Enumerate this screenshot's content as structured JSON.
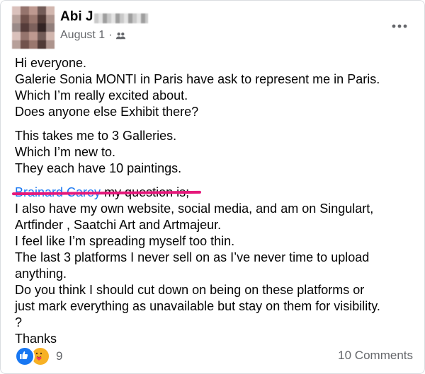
{
  "post": {
    "author_name": "Abi J",
    "date": "August 1",
    "separator": "·",
    "audience_icon": "friends-icon",
    "more_icon": "more-horizontal-icon"
  },
  "body": {
    "paragraph1": [
      "Hi everyone.",
      "Galerie Sonia MONTI in Paris have ask to represent me in Paris.",
      "Which I’m really excited about.",
      "Does anyone else Exhibit there?"
    ],
    "paragraph2": [
      "This takes me to 3 Galleries.",
      "Which I’m new to.",
      "They each have 10 paintings."
    ],
    "mention": "Brainard Carey",
    "mention_suffix": " my question is;",
    "paragraph3": [
      "I also have my own website, social media, and am on Singulart,",
      "Artfinder , Saatchi Art and Artmajeur.",
      "I feel like I’m spreading myself too thin.",
      "The last 3 platforms I never sell on as I’ve never time to upload",
      "anything.",
      "Do you think I should cut down on being on these platforms or",
      "just mark everything as unavailable but stay on them for visibility.",
      "?",
      "Thanks"
    ]
  },
  "footer": {
    "reaction_count": "9",
    "comments_label": "10 Comments",
    "reactions": [
      "like-reaction-icon",
      "care-reaction-icon"
    ]
  },
  "colors": {
    "link": "#1877f2",
    "secondary_text": "#65676b",
    "highlight_underline": "#e5197b"
  }
}
